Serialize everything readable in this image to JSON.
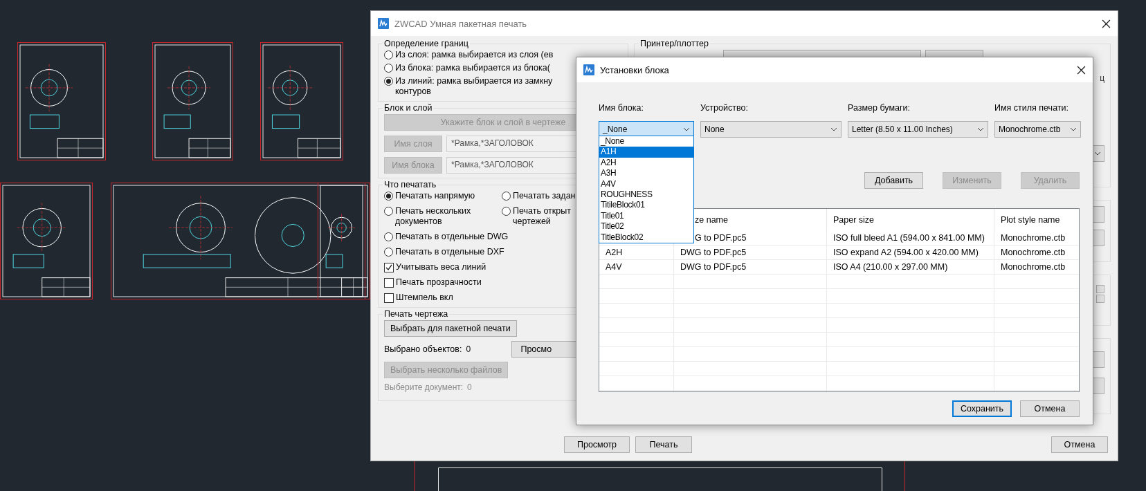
{
  "main_window": {
    "title": "ZWCAD Умная пакетная печать",
    "boundary_group": {
      "label": "Определение границ",
      "options": [
        {
          "lines": [
            "Из слоя: рамка выбирается из слоя (ев"
          ],
          "selected": false
        },
        {
          "lines": [
            "Из блока: рамка выбирается из блока("
          ],
          "selected": false
        },
        {
          "lines": [
            "Из линий: рамка выбирается из замкну",
            "контуров"
          ],
          "selected": true
        }
      ]
    },
    "block_layer_group": {
      "label": "Блок и слой",
      "pick_button": {
        "label": "Укажите блок и слой в чертеже",
        "disabled": true
      },
      "fields": [
        {
          "button": "Имя слоя",
          "value": "*Рамка,*ЗАГОЛОВОК",
          "disabled": true
        },
        {
          "button": "Имя блока",
          "value": "*Рамка,*ЗАГОЛОВОК",
          "disabled": true
        }
      ]
    },
    "print_what_group": {
      "label": "Что печатать",
      "rows": [
        {
          "items": [
            {
              "kind": "radio",
              "lines": [
                "Печатать напрямую"
              ],
              "selected": true
            },
            {
              "kind": "radio",
              "lines": [
                "Печатать задан"
              ],
              "selected": false
            }
          ]
        },
        {
          "items": [
            {
              "kind": "radio",
              "lines": [
                "Печать нескольких",
                "документов"
              ],
              "selected": false
            },
            {
              "kind": "radio",
              "lines": [
                "Печать открыт",
                "чертежей"
              ],
              "selected": false
            }
          ]
        },
        {
          "items": [
            {
              "kind": "radio",
              "lines": [
                "Печатать в отдельные DWG"
              ],
              "selected": false
            }
          ]
        },
        {
          "items": [
            {
              "kind": "radio",
              "lines": [
                "Печатать в отдельные DXF"
              ],
              "selected": false
            }
          ]
        },
        {
          "items": [
            {
              "kind": "checkbox",
              "lines": [
                "Учитывать веса линий"
              ],
              "checked": true
            }
          ]
        },
        {
          "items": [
            {
              "kind": "checkbox",
              "lines": [
                "Печать прозрачности"
              ],
              "checked": false
            }
          ]
        },
        {
          "items": [
            {
              "kind": "checkbox",
              "lines": [
                "Штемпель вкл"
              ],
              "checked": false
            }
          ]
        }
      ]
    },
    "drawing_group": {
      "label": "Печать чертежа",
      "select_button": {
        "label": "Выбрать для пакетной печати",
        "disabled": false
      },
      "selected_label": "Выбрано объектов:",
      "selected_count": "0",
      "preview_button": {
        "label": "Просмо",
        "disabled": false
      },
      "files_button": {
        "label": "Выбрать несколько файлов",
        "disabled": true
      },
      "document_label": "Выберите документ:",
      "document_count": "0"
    },
    "printer_group": {
      "label": "Принтер/плоттер",
      "partial_text": "ц"
    },
    "buttons": [
      {
        "label": "Просмотр"
      },
      {
        "label": "Печать"
      },
      {
        "label": "Отмена"
      }
    ]
  },
  "block_dialog": {
    "title": "Установки блока",
    "fields": [
      {
        "label": "Имя блока:",
        "value": "_None",
        "focused": true
      },
      {
        "label": "Устройство:",
        "value": "None",
        "focused": false
      },
      {
        "label": "Размер бумаги:",
        "value": "Letter (8.50 x 11.00 Inches)",
        "focused": false
      },
      {
        "label": "Имя стиля печати:",
        "value": "Monochrome.ctb",
        "focused": false
      }
    ],
    "dropdown": {
      "items": [
        {
          "label": "_None",
          "selected": false
        },
        {
          "label": "A1H",
          "selected": true
        },
        {
          "label": "A2H",
          "selected": false
        },
        {
          "label": "A3H",
          "selected": false
        },
        {
          "label": "A4V",
          "selected": false
        },
        {
          "label": "ROUGHNESS",
          "selected": false
        },
        {
          "label": "TitileBlock01",
          "selected": false
        },
        {
          "label": "Title01",
          "selected": false
        },
        {
          "label": "Title02",
          "selected": false
        },
        {
          "label": "TitleBlock02",
          "selected": false
        }
      ]
    },
    "buttons": [
      {
        "label": "Добавить",
        "disabled": false
      },
      {
        "label": "Изменить",
        "disabled": true
      },
      {
        "label": "Удалить",
        "disabled": true
      }
    ],
    "table": {
      "columns": {
        "column_2": "ze name",
        "paper_size": "Paper size",
        "plot_style_name": "Plot style name"
      },
      "rows": [
        {
          "device": "G to PDF.pc5",
          "paper": "ISO full bleed A1 (594.00 x 841.00 MM)",
          "style": "Monochrome.ctb"
        },
        {
          "block": "A2H",
          "device": "DWG to PDF.pc5",
          "paper": "ISO expand A2 (594.00 x 420.00 MM)",
          "style": "Monochrome.ctb"
        },
        {
          "block": "A4V",
          "device": "DWG to PDF.pc5",
          "paper": "ISO A4 (210.00 x 297.00 MM)",
          "style": "Monochrome.ctb"
        }
      ]
    },
    "footer_buttons": [
      {
        "label": "Сохранить",
        "default": true
      },
      {
        "label": "Отмена",
        "default": false
      }
    ]
  }
}
